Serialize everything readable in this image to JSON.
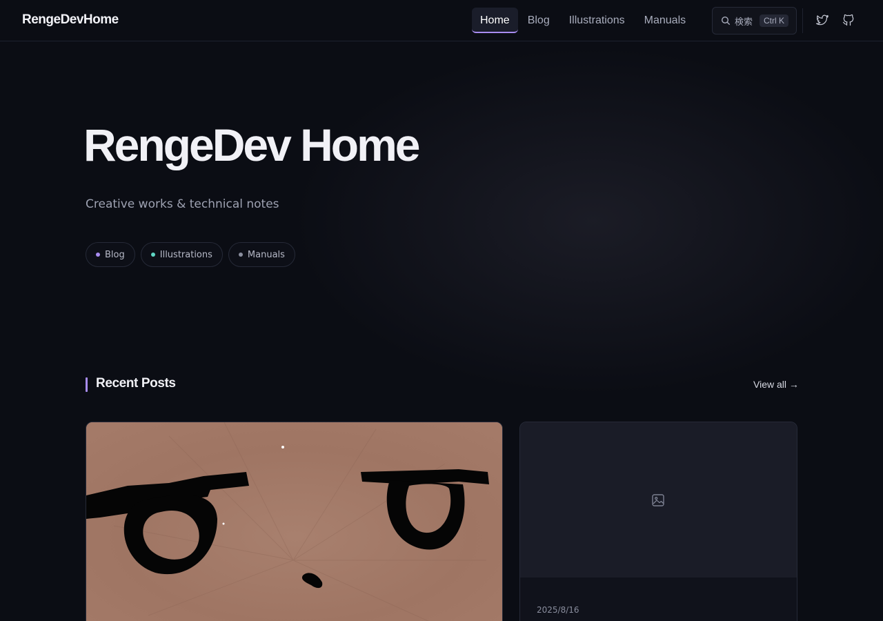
{
  "header": {
    "logo": "RengeDevHome",
    "nav": [
      {
        "label": "Home",
        "active": true
      },
      {
        "label": "Blog",
        "active": false
      },
      {
        "label": "Illustrations",
        "active": false
      },
      {
        "label": "Manuals",
        "active": false
      }
    ],
    "search": {
      "label": "検索",
      "shortcut": "Ctrl K"
    },
    "social_icons": [
      "twitter-icon",
      "github-icon"
    ]
  },
  "hero": {
    "title": "RengeDev Home",
    "subtitle": "Creative works & technical notes",
    "chips": [
      {
        "label": "Blog",
        "color": "#a88cf0"
      },
      {
        "label": "Illustrations",
        "color": "#5fd6c4"
      },
      {
        "label": "Manuals",
        "color": "#8a8e9e"
      }
    ]
  },
  "recent": {
    "title": "Recent Posts",
    "view_all": "View all →",
    "cards": [
      {
        "type": "illustration"
      },
      {
        "type": "no-image",
        "date": "2025/8/16"
      }
    ]
  },
  "colors": {
    "accent": "#a88cf0",
    "background": "#0b0d14"
  }
}
